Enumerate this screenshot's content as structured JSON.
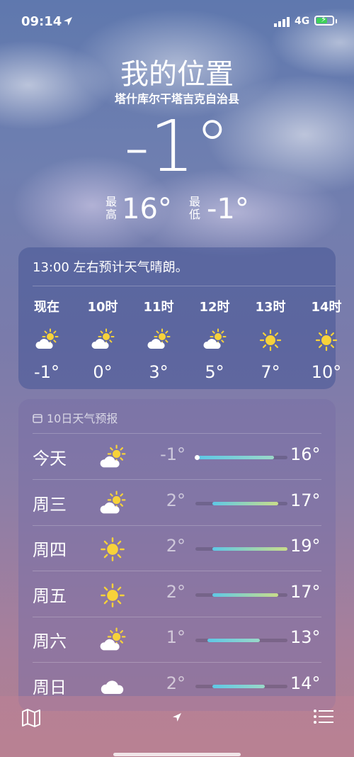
{
  "status": {
    "time": "09:14",
    "network": "4G"
  },
  "header": {
    "location": "我的位置",
    "sublocation": "塔什库尔干塔吉克自治县",
    "temperature": "-1°",
    "high_label": "最高",
    "high": "16°",
    "low_label": "最低",
    "low": "-1°"
  },
  "hourly": {
    "summary": "13:00 左右预计天气晴朗。",
    "items": [
      {
        "label": "现在",
        "icon": "partly-sunny-icon",
        "temp": "-1°"
      },
      {
        "label": "10时",
        "icon": "partly-sunny-icon",
        "temp": "0°"
      },
      {
        "label": "11时",
        "icon": "partly-sunny-icon",
        "temp": "3°"
      },
      {
        "label": "12时",
        "icon": "partly-sunny-icon",
        "temp": "5°"
      },
      {
        "label": "13时",
        "icon": "sun-icon",
        "temp": "7°"
      },
      {
        "label": "14时",
        "icon": "sun-icon",
        "temp": "10°"
      }
    ]
  },
  "daily": {
    "header": "10日天气预报",
    "days": [
      {
        "name": "今天",
        "icon": "partly-sunny-icon",
        "low": "-1°",
        "high": "16°",
        "range": [
          -1,
          16
        ],
        "current": -1
      },
      {
        "name": "周三",
        "icon": "partly-sunny-icon",
        "low": "2°",
        "high": "17°",
        "range": [
          2,
          17
        ]
      },
      {
        "name": "周四",
        "icon": "sun-icon",
        "low": "2°",
        "high": "19°",
        "range": [
          2,
          19
        ]
      },
      {
        "name": "周五",
        "icon": "sun-icon",
        "low": "2°",
        "high": "17°",
        "range": [
          2,
          17
        ]
      },
      {
        "name": "周六",
        "icon": "partly-sunny-icon",
        "low": "1°",
        "high": "13°",
        "range": [
          1,
          13
        ]
      },
      {
        "name": "周日",
        "icon": "cloud-icon",
        "low": "2°",
        "high": "14°",
        "range": [
          2,
          14
        ]
      }
    ],
    "scale": [
      -1,
      19
    ]
  },
  "colors": {
    "bar_cool": "#5ec8e6",
    "bar_warm": "#c9dd8a",
    "sun": "#f7d23a"
  }
}
